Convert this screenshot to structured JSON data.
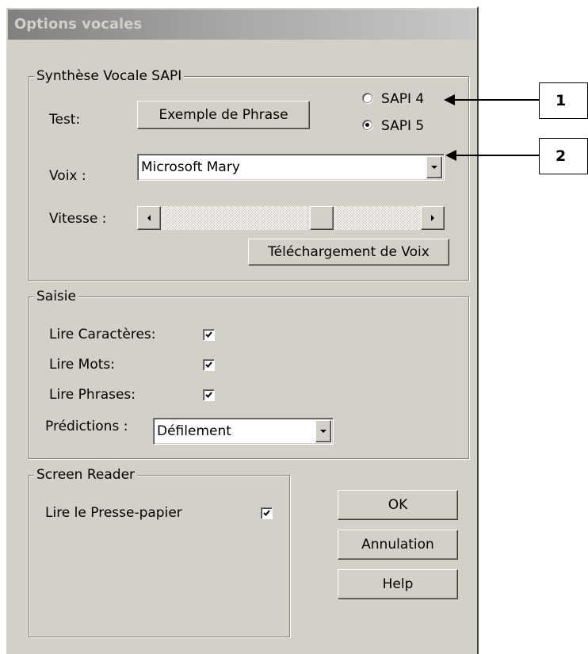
{
  "window": {
    "title": "Options vocales"
  },
  "sapi_group": {
    "legend": "Synthèse Vocale SAPI",
    "test_label": "Test:",
    "example_button": "Exemple de Phrase",
    "radio_sapi4": {
      "label": "SAPI 4",
      "checked": false
    },
    "radio_sapi5": {
      "label": "SAPI 5",
      "checked": true
    },
    "voice_label": "Voix :",
    "voice_value": "Microsoft Mary",
    "speed_label": "Vitesse :",
    "speed_level_percent": 63,
    "download_button": "Téléchargement de Voix"
  },
  "input_group": {
    "legend": "Saisie",
    "read_chars": {
      "label": "Lire Caractères:",
      "checked": true
    },
    "read_words": {
      "label": "Lire Mots:",
      "checked": true
    },
    "read_sentences": {
      "label": "Lire Phrases:",
      "checked": true
    },
    "predictions_label": "Prédictions :",
    "predictions_value": "Défilement"
  },
  "screen_reader_group": {
    "legend": "Screen Reader",
    "read_clipboard": {
      "label": "Lire le Presse-papier",
      "checked": true
    }
  },
  "buttons": {
    "ok": "OK",
    "cancel": "Annulation",
    "help": "Help"
  },
  "callouts": [
    {
      "number": "1"
    },
    {
      "number": "2"
    }
  ]
}
